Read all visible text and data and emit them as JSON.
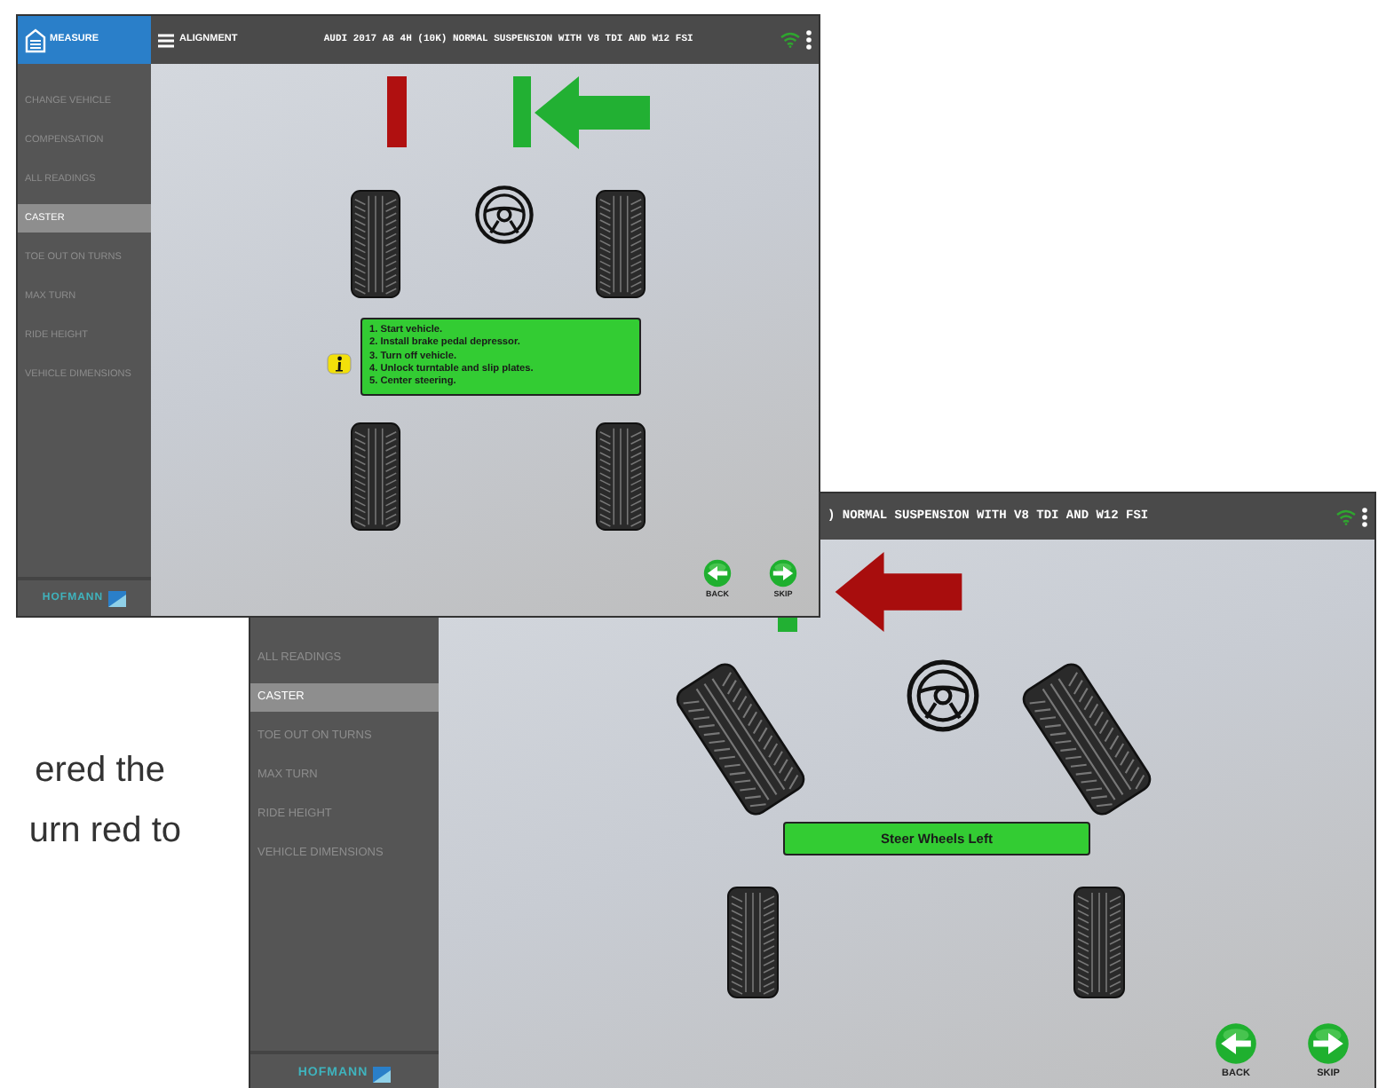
{
  "document_text": [
    "ered the",
    "urn red to"
  ],
  "screens": [
    {
      "kind": "instructions",
      "app_name": "MEASURE",
      "menu_label": "ALIGNMENT",
      "vehicle_title": "AUDI 2017 A8 4H (10K) NORMAL SUSPENSION WITH V8 TDI AND W12 FSI",
      "sidebar": [
        {
          "label": "CHANGE VEHICLE",
          "selected": false
        },
        {
          "label": "COMPENSATION",
          "selected": false
        },
        {
          "label": "ALL READINGS",
          "selected": false
        },
        {
          "label": "CASTER",
          "selected": true
        },
        {
          "label": "TOE OUT ON TURNS",
          "selected": false
        },
        {
          "label": "MAX TURN",
          "selected": false
        },
        {
          "label": "RIDE HEIGHT",
          "selected": false
        },
        {
          "label": "VEHICLE DIMENSIONS",
          "selected": false
        }
      ],
      "brand": "HOFMANN",
      "instructions": [
        "1. Start vehicle.",
        "2. Install brake pedal depressor.",
        "3. Turn off vehicle.",
        "4. Unlock turntable and slip plates.",
        "5. Center steering."
      ],
      "buttons": [
        {
          "kind": "back",
          "label": "BACK"
        },
        {
          "kind": "skip",
          "label": "SKIP"
        }
      ]
    },
    {
      "kind": "steer",
      "vehicle_title": ") NORMAL SUSPENSION WITH V8 TDI AND W12 FSI",
      "sidebar": [
        {
          "label": "ALL READINGS",
          "selected": false
        },
        {
          "label": "CASTER",
          "selected": true
        },
        {
          "label": "TOE OUT ON TURNS",
          "selected": false
        },
        {
          "label": "MAX TURN",
          "selected": false
        },
        {
          "label": "RIDE HEIGHT",
          "selected": false
        },
        {
          "label": "VEHICLE DIMENSIONS",
          "selected": false
        }
      ],
      "brand": "HOFMANN",
      "message": "Steer Wheels Left",
      "buttons": [
        {
          "kind": "back",
          "label": "BACK"
        },
        {
          "kind": "skip",
          "label": "SKIP"
        }
      ]
    }
  ]
}
